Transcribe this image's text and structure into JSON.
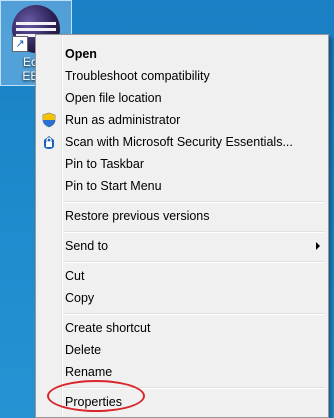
{
  "desktop_icon": {
    "caption_line1": "Eclip",
    "caption_line2": "EE P"
  },
  "context_menu": {
    "items": [
      {
        "label": "Open",
        "bold": true,
        "icon": ""
      },
      {
        "label": "Troubleshoot compatibility",
        "icon": ""
      },
      {
        "label": "Open file location",
        "icon": ""
      },
      {
        "label": "Run as administrator",
        "icon": "uac-shield-icon"
      },
      {
        "label": "Scan with Microsoft Security Essentials...",
        "icon": "security-essentials-icon"
      },
      {
        "label": "Pin to Taskbar",
        "icon": ""
      },
      {
        "label": "Pin to Start Menu",
        "icon": ""
      },
      {
        "label": "Restore previous versions",
        "icon": ""
      },
      {
        "label": "Send to",
        "icon": "",
        "submenu": true
      },
      {
        "label": "Cut",
        "icon": ""
      },
      {
        "label": "Copy",
        "icon": ""
      },
      {
        "label": "Create shortcut",
        "icon": ""
      },
      {
        "label": "Delete",
        "icon": ""
      },
      {
        "label": "Rename",
        "icon": ""
      },
      {
        "label": "Properties",
        "icon": "",
        "highlighted_annotation": true
      }
    ]
  },
  "annotation_color": "#d9252a"
}
